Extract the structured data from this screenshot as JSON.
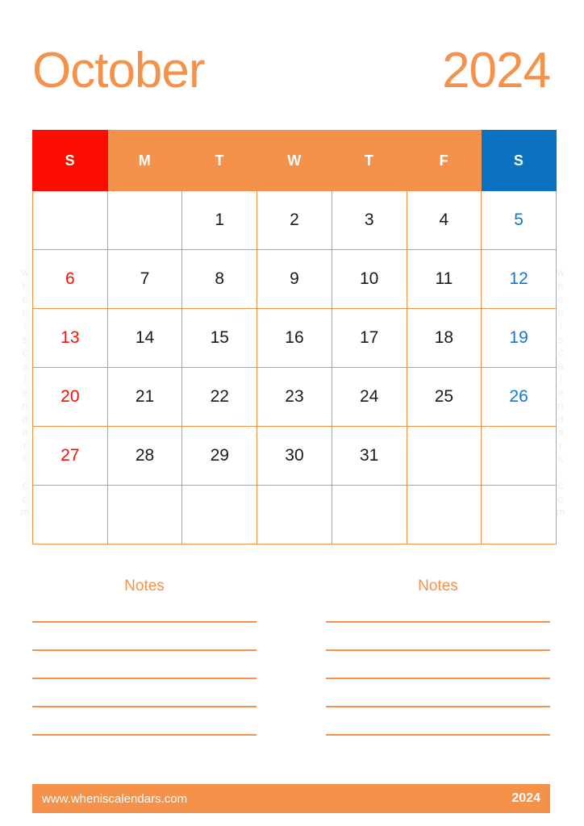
{
  "header": {
    "month": "October",
    "year": "2024"
  },
  "watermark": {
    "text": "wheniscalendars.com"
  },
  "calendar": {
    "weekday_headers": [
      {
        "label": "S",
        "kind": "sunday"
      },
      {
        "label": "M",
        "kind": "weekday"
      },
      {
        "label": "T",
        "kind": "weekday"
      },
      {
        "label": "W",
        "kind": "weekday"
      },
      {
        "label": "T",
        "kind": "weekday"
      },
      {
        "label": "F",
        "kind": "weekday"
      },
      {
        "label": "S",
        "kind": "saturday"
      }
    ],
    "weeks": [
      [
        "",
        "",
        "1",
        "2",
        "3",
        "4",
        "5"
      ],
      [
        "6",
        "7",
        "8",
        "9",
        "10",
        "11",
        "12"
      ],
      [
        "13",
        "14",
        "15",
        "16",
        "17",
        "18",
        "19"
      ],
      [
        "20",
        "21",
        "22",
        "23",
        "24",
        "25",
        "26"
      ],
      [
        "27",
        "28",
        "29",
        "30",
        "31",
        "",
        ""
      ],
      [
        "",
        "",
        "",
        "",
        "",
        "",
        ""
      ]
    ],
    "colors": {
      "accent_orange": "#f4924c",
      "sunday_red": "#fc0d02",
      "saturday_blue": "#0a72c0",
      "saturday_date_blue": "#1177d1",
      "date_text": "#1a1a1a",
      "watermark_gray": "#ededed"
    }
  },
  "notes": {
    "columns": [
      {
        "heading": "Notes",
        "lines": 5
      },
      {
        "heading": "Notes",
        "lines": 5
      }
    ]
  },
  "footer": {
    "website": "www.wheniscalendars.com",
    "year": "2024"
  }
}
